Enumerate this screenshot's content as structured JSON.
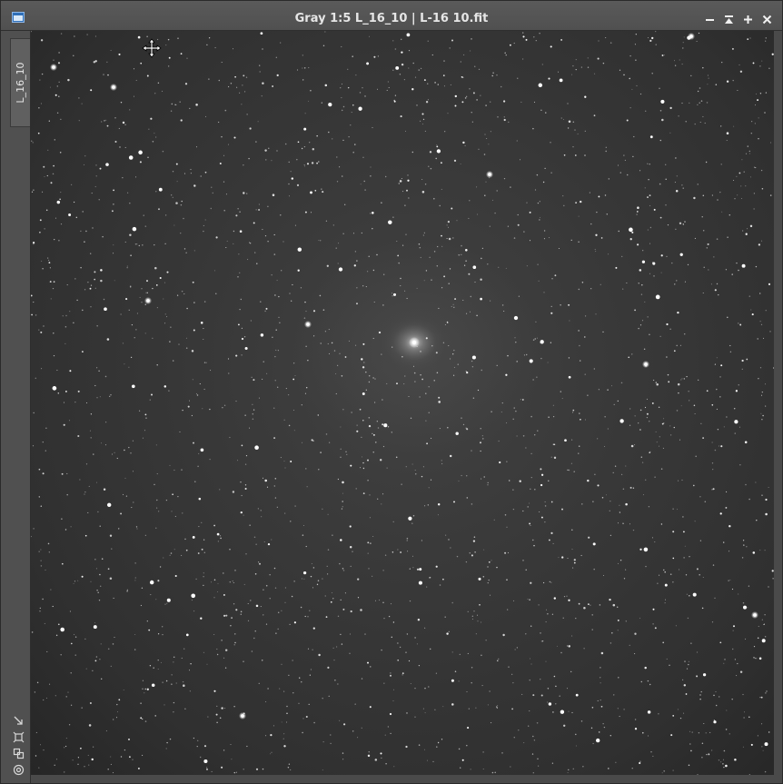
{
  "window": {
    "title": "Gray 1:5 L_16_10 | L-16 10.fit",
    "icon": "image-window-icon"
  },
  "title_controls": [
    {
      "name": "minimize-icon"
    },
    {
      "name": "shade-icon"
    },
    {
      "name": "maximize-icon"
    },
    {
      "name": "close-icon"
    }
  ],
  "side_tab": {
    "label": "L_16_10"
  },
  "side_tools": [
    {
      "name": "fit-view-icon"
    },
    {
      "name": "crop-mode-icon"
    },
    {
      "name": "clone-view-icon"
    },
    {
      "name": "target-icon"
    }
  ],
  "image": {
    "description_colors": {
      "background": "#333333",
      "nebula": "#6a6a6a",
      "star": "#ffffff"
    }
  },
  "cursor": {
    "icon": "move-cursor-icon"
  }
}
